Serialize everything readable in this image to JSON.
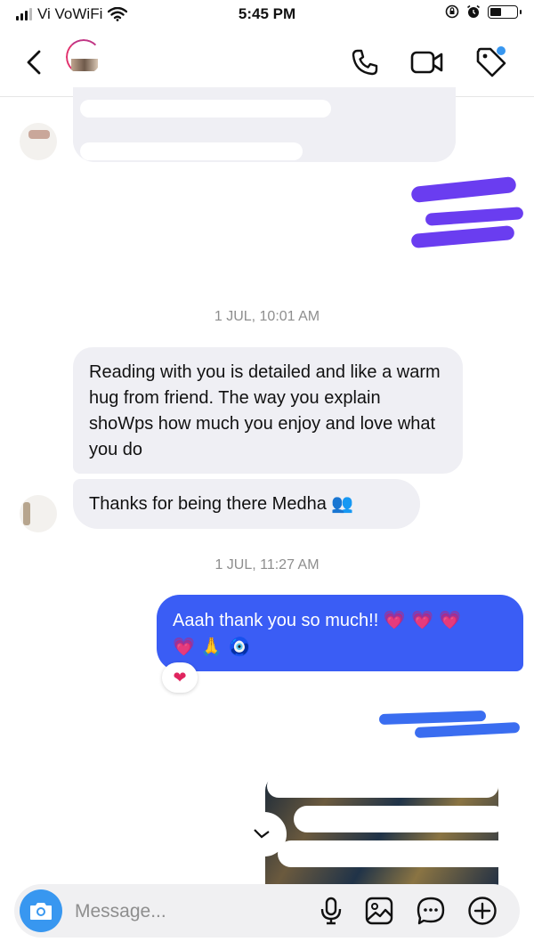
{
  "status_bar": {
    "carrier": "Vi VoWiFi",
    "time": "5:45 PM",
    "icons": [
      "signal-icon",
      "wifi-icon",
      "screen-lock-icon",
      "alarm-icon",
      "battery-icon"
    ]
  },
  "header": {
    "back_icon": "chevron-left-icon",
    "action_icons": [
      "phone-icon",
      "video-camera-icon",
      "tag-icon"
    ]
  },
  "messages": {
    "timestamp_1": "1 JUL, 10:01 AM",
    "incoming_1": "Reading with you is detailed and like a warm hug from friend. The way you explain shoWps how much you enjoy and love what you do",
    "incoming_2_text": "Thanks for being there Medha",
    "incoming_2_emoji": "👥",
    "timestamp_2": "1 JUL, 11:27 AM",
    "outgoing_1_text": "Aaah thank you so much!!",
    "outgoing_1_emoji_line1": "💗 💗 💗",
    "outgoing_1_emoji_line2": "💗 🙏 🧿",
    "reaction": "❤"
  },
  "composer": {
    "placeholder": "Message...",
    "icons": [
      "camera-icon",
      "microphone-icon",
      "gallery-icon",
      "sticker-chat-icon",
      "plus-circle-icon"
    ]
  },
  "colors": {
    "outgoing_bubble": "#3a5df5",
    "incoming_bubble": "#efeff4",
    "accent_blue": "#3897f0",
    "timestamp_gray": "#8e8e8e"
  }
}
